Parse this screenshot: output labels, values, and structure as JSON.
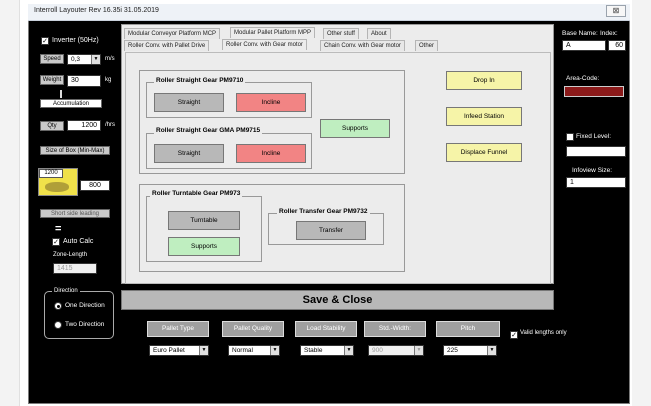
{
  "window": {
    "title": "Interroll Layouter Rev 16.35i  31.05.2019",
    "close_label": "⊠"
  },
  "left": {
    "inverter_label": "Inverter (50Hz)",
    "speed_label": "Speed",
    "speed_value": "0,3",
    "speed_unit": "m/s",
    "weight_label": "Weight",
    "weight_value": "30",
    "weight_unit": "kg",
    "accumulation_label": "Accumulation",
    "qty_label": "Qty",
    "qty_value": "1200",
    "qty_unit": "/hrs",
    "size_box_label": "Size of Box (Min-Max)",
    "size_top": "1200",
    "size_right": "800",
    "short_side_label": "Short side leading",
    "equals_glyph": "=",
    "auto_calc_label": "Auto Calc",
    "zone_length_label": "Zone-Length",
    "zone_length_value": "1415",
    "direction_label": "Direction",
    "one_direction": "One Direction",
    "two_direction": "Two Direction"
  },
  "tabs_top": [
    "Modular Conveyor Platform MCP",
    "Modular Pallet Platform MPP",
    "Other stuff",
    "About"
  ],
  "tabs_sub": [
    "Roller Conv. with Pallet Drive",
    "Roller Conv. with Gear motor",
    "Chain Conv. with Gear motor",
    "Other"
  ],
  "groups": {
    "straight": {
      "title": "Roller Straight  Gear PM9710",
      "b1": "Straight",
      "b2": "Incline"
    },
    "gma": {
      "title": "Roller Straight  Gear GMA PM9715",
      "b1": "Straight",
      "b2": "Incline"
    },
    "supports_mid": "Supports",
    "turntable": {
      "title": "Roller Turntable  Gear PM973",
      "b1": "Turntable",
      "b2": "Supports"
    },
    "transfer": {
      "title": "Roller Transfer  Gear PM9732",
      "b1": "Transfer"
    },
    "drop_in": "Drop In",
    "infeed": "Infeed Station",
    "displace": "Displace Funnel"
  },
  "right": {
    "base_name_label": "Base Name:",
    "index_label": "Index:",
    "base_name_value": "A",
    "index_value": "60",
    "area_code_label": "Area-Code:",
    "area_code_color": "#8b1a1a",
    "fixed_level_label": "Fixed Level:",
    "infeed_size_label": "Infoview Size:",
    "infeed_size_value": "1"
  },
  "save_label": "Save & Close",
  "bottom": {
    "cols": [
      {
        "header": "Pallet Type",
        "value": "Euro Pallet",
        "disabled": false
      },
      {
        "header": "Pallet Quality",
        "value": "Normal",
        "disabled": false
      },
      {
        "header": "Load Stability",
        "value": "Stable",
        "disabled": false
      },
      {
        "header": "Std.-Width:",
        "value": "900",
        "disabled": true
      },
      {
        "header": "Pitch",
        "value": "225",
        "disabled": false
      }
    ],
    "valid_lengths_label": "Valid lengths only"
  }
}
